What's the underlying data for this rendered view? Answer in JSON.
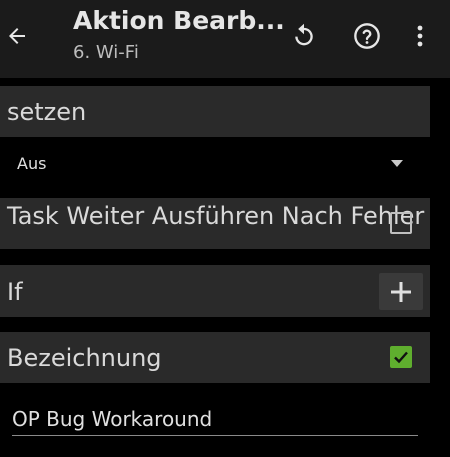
{
  "appbar": {
    "title": "Aktion Bearb...",
    "subtitle": "6. Wi-Fi",
    "back_icon": "arrow-left-icon",
    "actions": [
      "undo-icon",
      "help-icon",
      "more-vert-icon"
    ]
  },
  "sections": {
    "setzen": {
      "label": "setzen"
    },
    "dropdown": {
      "value": "Aus"
    },
    "continue_after_error": {
      "label": "Task Weiter Ausführen Nach Fehler",
      "checked": false
    },
    "if": {
      "label": "If"
    },
    "label_section": {
      "label": "Bezeichnung",
      "checked": true
    },
    "label_field": {
      "value": "OP Bug Workaround"
    }
  },
  "colors": {
    "appbar_bg": "#1b1b1b",
    "row_bg": "#2a2a2a",
    "check_green": "#5fae2e",
    "page_bg": "#000000"
  }
}
